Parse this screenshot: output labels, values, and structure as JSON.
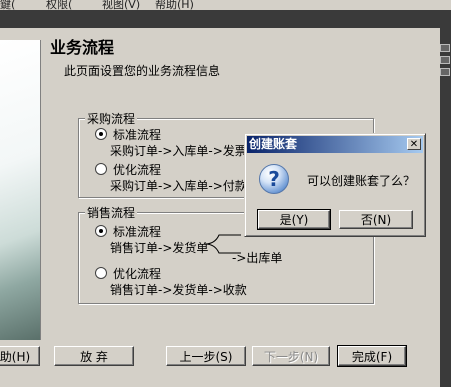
{
  "menubar": {
    "items": [
      "鍵(",
      "权限(",
      "视图(V)",
      "帮助(H)"
    ]
  },
  "wizard": {
    "title": "业务流程",
    "description": "此页面设置您的业务流程信息",
    "purchase": {
      "label": "采购流程",
      "standard": {
        "label": "标准流程",
        "flow": "采购订单->入库单->发票",
        "checked": true
      },
      "optimized": {
        "label": "优化流程",
        "flow": "采购订单->入库单->付款",
        "checked": false
      }
    },
    "sales": {
      "label": "销售流程",
      "standard": {
        "label": "标准流程",
        "flow": "销售订单->发货单",
        "branch": "->出库单",
        "checked": true
      },
      "optimized": {
        "label": "优化流程",
        "flow": "销售订单->发货单->收款",
        "checked": false
      }
    },
    "buttons": {
      "help": "助(H)",
      "cancel": "放 弃",
      "prev": "上一步(S)",
      "next": "下一步(N)",
      "finish": "完成(F)"
    }
  },
  "dialog": {
    "title": "创建账套",
    "close": "✕",
    "icon": "question-icon",
    "message": "可以创建账套了么？",
    "yes": "是(Y)",
    "no": "否(N)"
  }
}
